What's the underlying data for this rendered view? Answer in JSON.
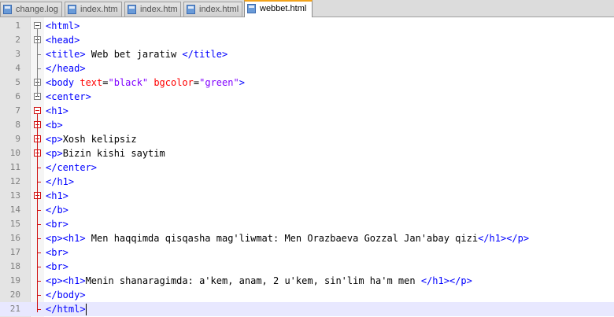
{
  "tabs": [
    {
      "label": "change.log",
      "active": false
    },
    {
      "label": "index.htm",
      "active": false
    },
    {
      "label": "index.htm",
      "active": false
    },
    {
      "label": "index.html",
      "active": false
    },
    {
      "label": "webbet.html",
      "active": true
    }
  ],
  "editor": {
    "current_line": 21,
    "lines": [
      {
        "n": "1",
        "tokens": [
          [
            "tag",
            "<html>"
          ]
        ]
      },
      {
        "n": "2",
        "tokens": [
          [
            "tag",
            "<head>"
          ]
        ]
      },
      {
        "n": "3",
        "tokens": [
          [
            "tag",
            "<title>"
          ],
          [
            "txt",
            " Web bet jaratiw "
          ],
          [
            "tag",
            "</title>"
          ]
        ]
      },
      {
        "n": "4",
        "tokens": [
          [
            "tag",
            "</head>"
          ]
        ]
      },
      {
        "n": "5",
        "tokens": [
          [
            "tag",
            "<body "
          ],
          [
            "attr",
            "text"
          ],
          [
            "eq",
            "="
          ],
          [
            "val",
            "\"black\""
          ],
          [
            "txt",
            " "
          ],
          [
            "attr",
            "bgcolor"
          ],
          [
            "eq",
            "="
          ],
          [
            "val",
            "\"green\""
          ],
          [
            "tag",
            ">"
          ]
        ]
      },
      {
        "n": "6",
        "tokens": [
          [
            "tag",
            "<center>"
          ]
        ]
      },
      {
        "n": "7",
        "tokens": [
          [
            "tag",
            "<h1>"
          ]
        ]
      },
      {
        "n": "8",
        "tokens": [
          [
            "tag",
            "<b>"
          ]
        ]
      },
      {
        "n": "9",
        "tokens": [
          [
            "tag",
            "<p>"
          ],
          [
            "txt",
            "Xosh kelipsiz"
          ]
        ]
      },
      {
        "n": "10",
        "tokens": [
          [
            "tag",
            "<p>"
          ],
          [
            "txt",
            "Bizin kishi saytim"
          ]
        ]
      },
      {
        "n": "11",
        "tokens": [
          [
            "tag",
            "</center>"
          ]
        ]
      },
      {
        "n": "12",
        "tokens": [
          [
            "tag",
            "</h1>"
          ]
        ]
      },
      {
        "n": "13",
        "tokens": [
          [
            "tag",
            "<h1>"
          ]
        ]
      },
      {
        "n": "14",
        "tokens": [
          [
            "tag",
            "</b>"
          ]
        ]
      },
      {
        "n": "15",
        "tokens": [
          [
            "tag",
            "<br>"
          ]
        ]
      },
      {
        "n": "16",
        "tokens": [
          [
            "tag",
            "<p><h1>"
          ],
          [
            "txt",
            " Men haqqimda qisqasha mag'liwmat: Men Orazbaeva Gozzal Jan'abay qizi"
          ],
          [
            "tag",
            "</h1></p>"
          ]
        ]
      },
      {
        "n": "17",
        "tokens": [
          [
            "tag",
            "<br>"
          ]
        ]
      },
      {
        "n": "18",
        "tokens": [
          [
            "tag",
            "<br>"
          ]
        ]
      },
      {
        "n": "19",
        "tokens": [
          [
            "tag",
            "<p><h1>"
          ],
          [
            "txt",
            "Menin shanaragimda: a'kem, anam, 2 u'kem, sin'lim ha'm men "
          ],
          [
            "tag",
            "</h1></p>"
          ]
        ]
      },
      {
        "n": "20",
        "tokens": [
          [
            "tag",
            "</body>"
          ]
        ]
      },
      {
        "n": "21",
        "tokens": [
          [
            "tag",
            "</html>"
          ]
        ]
      }
    ]
  },
  "colors": {
    "tag": "#0000ff",
    "attr": "#ff0000",
    "value": "#8000ff",
    "text": "#000000",
    "fold_active": "#d01010",
    "active_tab_accent": "#f2a31c"
  }
}
